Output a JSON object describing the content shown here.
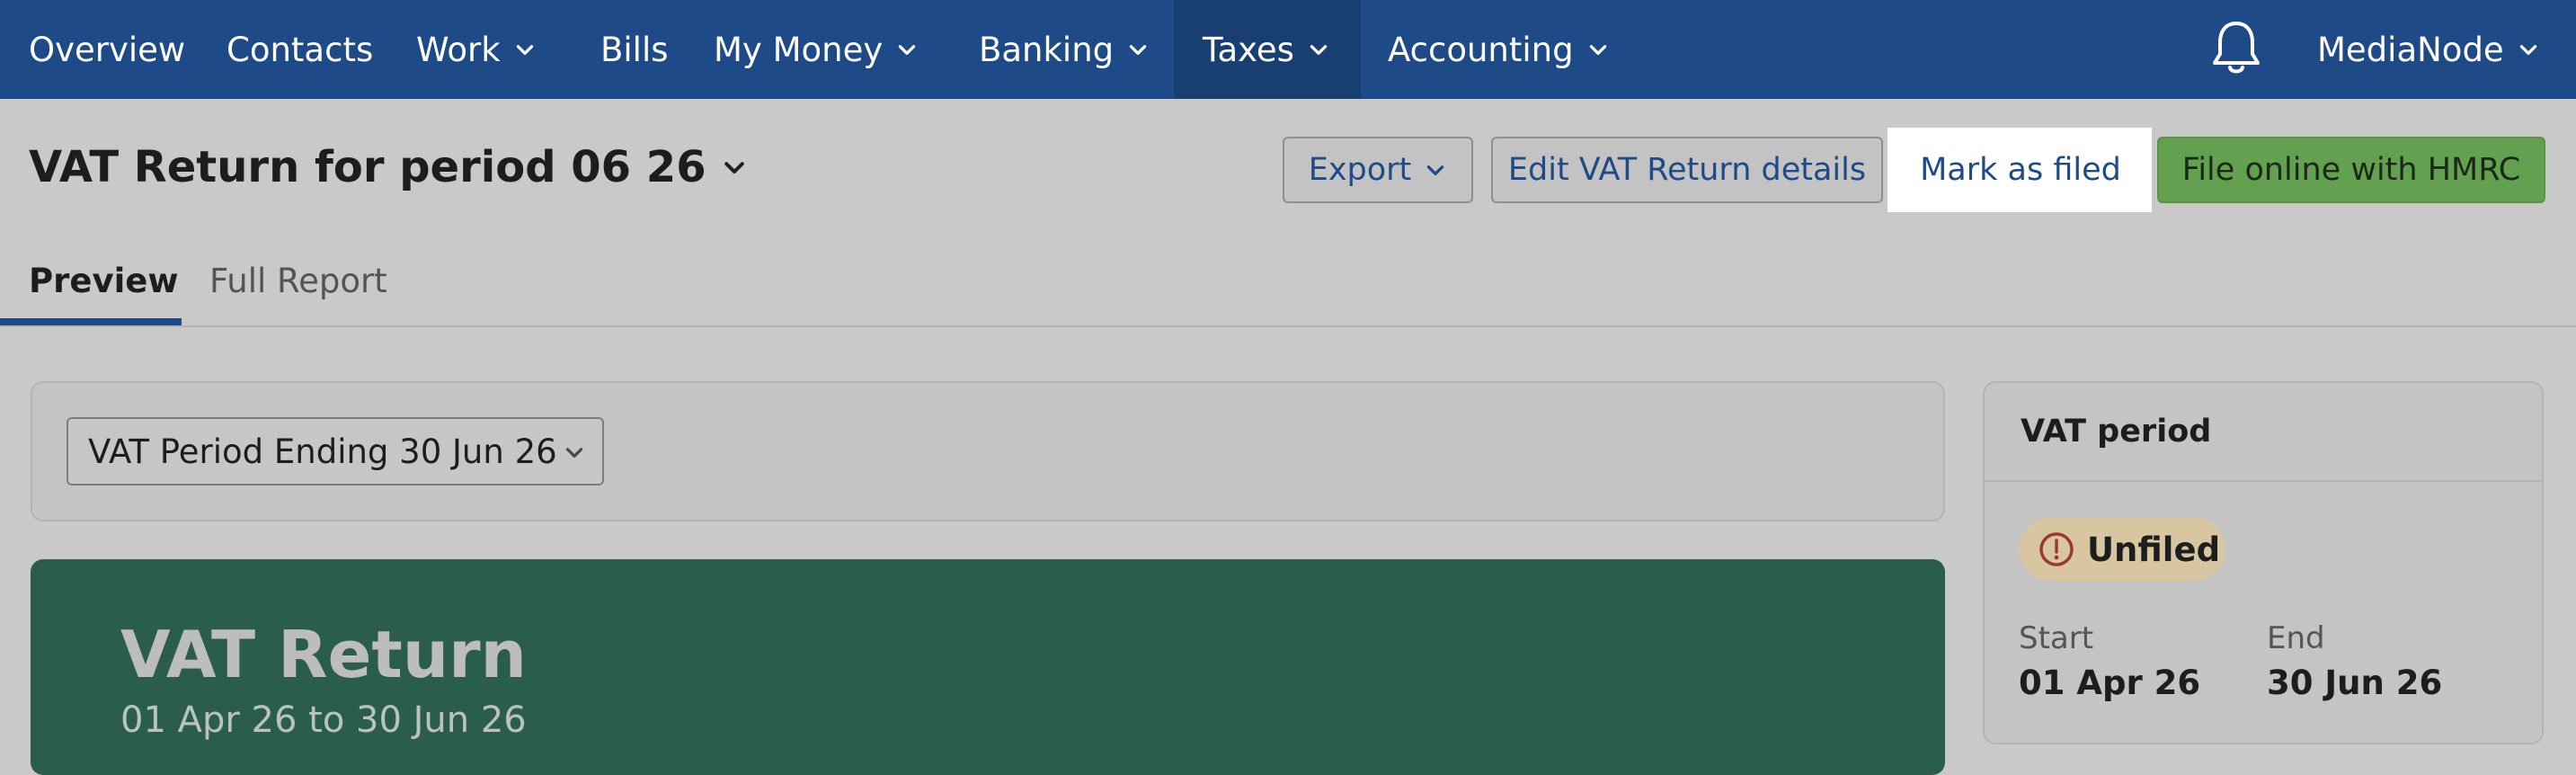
{
  "nav": {
    "items": [
      {
        "label": "Overview"
      },
      {
        "label": "Contacts"
      },
      {
        "label": "Work"
      },
      {
        "label": "Bills"
      },
      {
        "label": "My Money"
      },
      {
        "label": "Banking"
      },
      {
        "label": "Taxes"
      },
      {
        "label": "Accounting"
      }
    ],
    "active_item": "Taxes",
    "account_name": "MediaNode",
    "colors": {
      "bar": "#1e4a88",
      "active": "#183e72"
    }
  },
  "page": {
    "title": "VAT Return for period 06 26"
  },
  "toolbar": {
    "export_label": "Export",
    "edit_label": "Edit VAT Return details",
    "mark_filed_label": "Mark as filed",
    "file_online_label": "File online with HMRC"
  },
  "tabs": [
    {
      "label": "Preview",
      "active": true
    },
    {
      "label": "Full Report",
      "active": false
    }
  ],
  "period_select": {
    "value": "VAT Period Ending 30 Jun 26"
  },
  "vat_card": {
    "title": "VAT Return",
    "date_range": "01 Apr 26 to 30 Jun 26",
    "color": "#2b5d4f"
  },
  "vat_period": {
    "title": "VAT period",
    "status": "Unfiled",
    "status_icon": "exclamation-circle-icon",
    "start_label": "Start",
    "start_value": "01 Apr 26",
    "end_label": "End",
    "end_value": "30 Jun 26"
  }
}
